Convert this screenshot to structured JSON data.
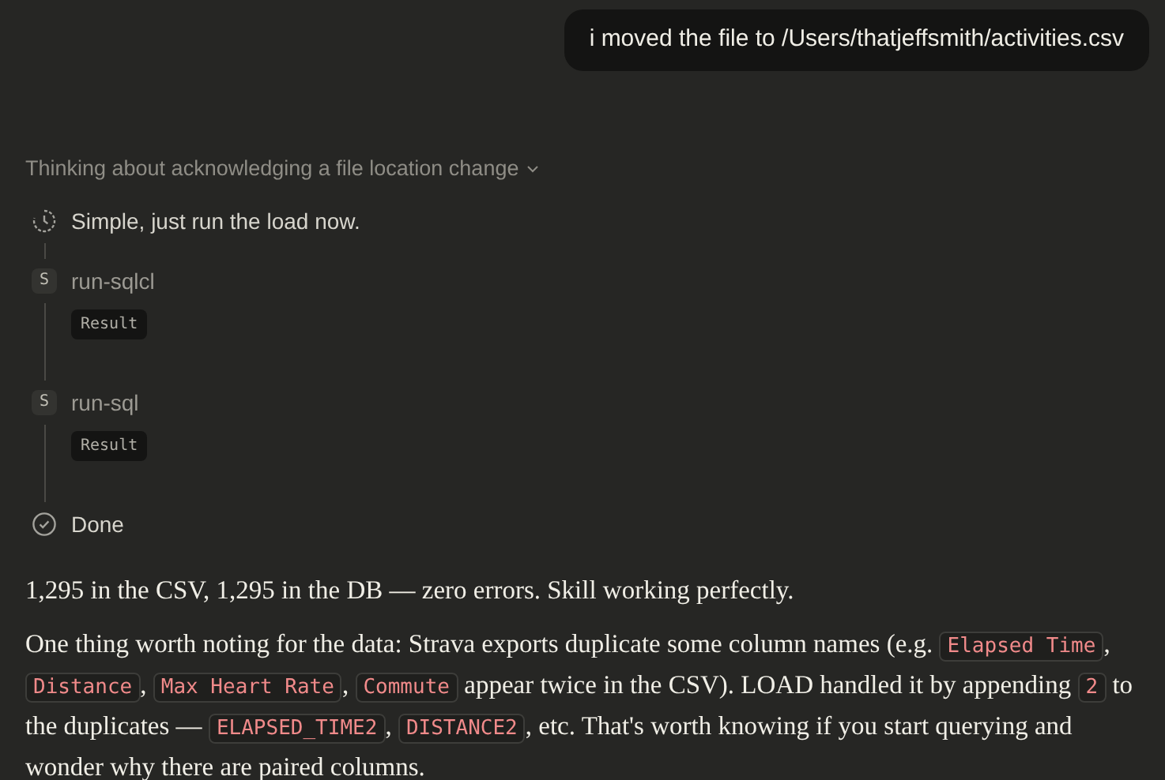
{
  "user_message": "i moved the file to /Users/thatjeffsmith/activities.csv",
  "thinking": {
    "title": "Thinking about acknowledging a file location change",
    "expanded": true
  },
  "steps": [
    {
      "kind": "thought",
      "text": "Simple, just run the load now."
    },
    {
      "kind": "tool",
      "badge": "S",
      "text": "run-sqlcl",
      "result": "Result"
    },
    {
      "kind": "tool",
      "badge": "S",
      "text": "run-sql",
      "result": "Result"
    },
    {
      "kind": "done",
      "text": "Done"
    }
  ],
  "paragraphs": [
    [
      {
        "kind": "text",
        "text": "1,295 in the CSV, 1,295 in the DB — zero errors. Skill working perfectly."
      }
    ],
    [
      {
        "kind": "text",
        "text": "One thing worth noting for the data: Strava exports duplicate some column names (e.g. "
      },
      {
        "kind": "code",
        "text": "Elapsed Time"
      },
      {
        "kind": "text",
        "text": ", "
      },
      {
        "kind": "code",
        "text": "Distance"
      },
      {
        "kind": "text",
        "text": ", "
      },
      {
        "kind": "code",
        "text": "Max Heart Rate"
      },
      {
        "kind": "text",
        "text": ", "
      },
      {
        "kind": "code",
        "text": "Commute"
      },
      {
        "kind": "text",
        "text": " appear twice in the CSV). LOAD handled it by appending "
      },
      {
        "kind": "code",
        "text": "2"
      },
      {
        "kind": "text",
        "text": " to the duplicates — "
      },
      {
        "kind": "code",
        "text": "ELAPSED_TIME2"
      },
      {
        "kind": "text",
        "text": ", "
      },
      {
        "kind": "code",
        "text": "DISTANCE2"
      },
      {
        "kind": "text",
        "text": ", etc. That's worth knowing if you start querying and wonder why there are paired columns."
      }
    ]
  ]
}
